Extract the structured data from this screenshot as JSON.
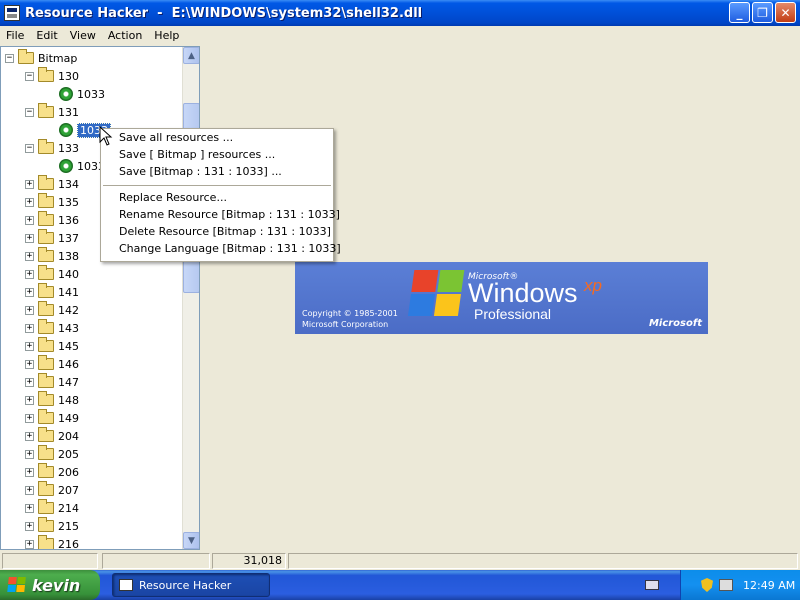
{
  "window": {
    "title": "Resource Hacker  -  E:\\WINDOWS\\system32\\shell32.dll",
    "minimize_glyph": "_",
    "maximize_glyph": "❐",
    "close_glyph": "✕"
  },
  "menu": [
    "File",
    "Edit",
    "View",
    "Action",
    "Help"
  ],
  "tree": {
    "root": "Bitmap",
    "expanded_130": "130",
    "leaf_130": "1033",
    "expanded_131": "131",
    "leaf_131_selected": "1033",
    "expanded_133": "133",
    "leaf_133": "1033",
    "collapsed_items": [
      "134",
      "135",
      "136",
      "137",
      "138",
      "140",
      "141",
      "142",
      "143",
      "145",
      "146",
      "147",
      "148",
      "149",
      "204",
      "205",
      "206",
      "207",
      "214",
      "215",
      "216"
    ]
  },
  "context_menu": {
    "items": [
      "Save all resources ...",
      "Save [ Bitmap ] resources ...",
      "Save [Bitmap : 131 : 1033] ...",
      "Replace Resource...",
      "Rename Resource [Bitmap : 131 : 1033]",
      "Delete Resource [Bitmap : 131 : 1033]",
      "Change Language [Bitmap : 131 : 1033]"
    ]
  },
  "splash": {
    "microsoft_small": "Microsoft®",
    "windows": "Windows",
    "xp": "xp",
    "professional": "Professional",
    "copyright_line1": "Copyright © 1985-2001",
    "copyright_line2": "Microsoft Corporation",
    "ms_logo": "Microsoft"
  },
  "statusbar": {
    "size_value": "31,018"
  },
  "taskbar": {
    "start_label": "kevin",
    "task_label": "Resource Hacker",
    "clock": "12:49 AM"
  },
  "icons": {
    "folder": "folder-icon",
    "resource": "resource-gear-icon",
    "expander_plus": "+",
    "expander_minus": "−"
  }
}
